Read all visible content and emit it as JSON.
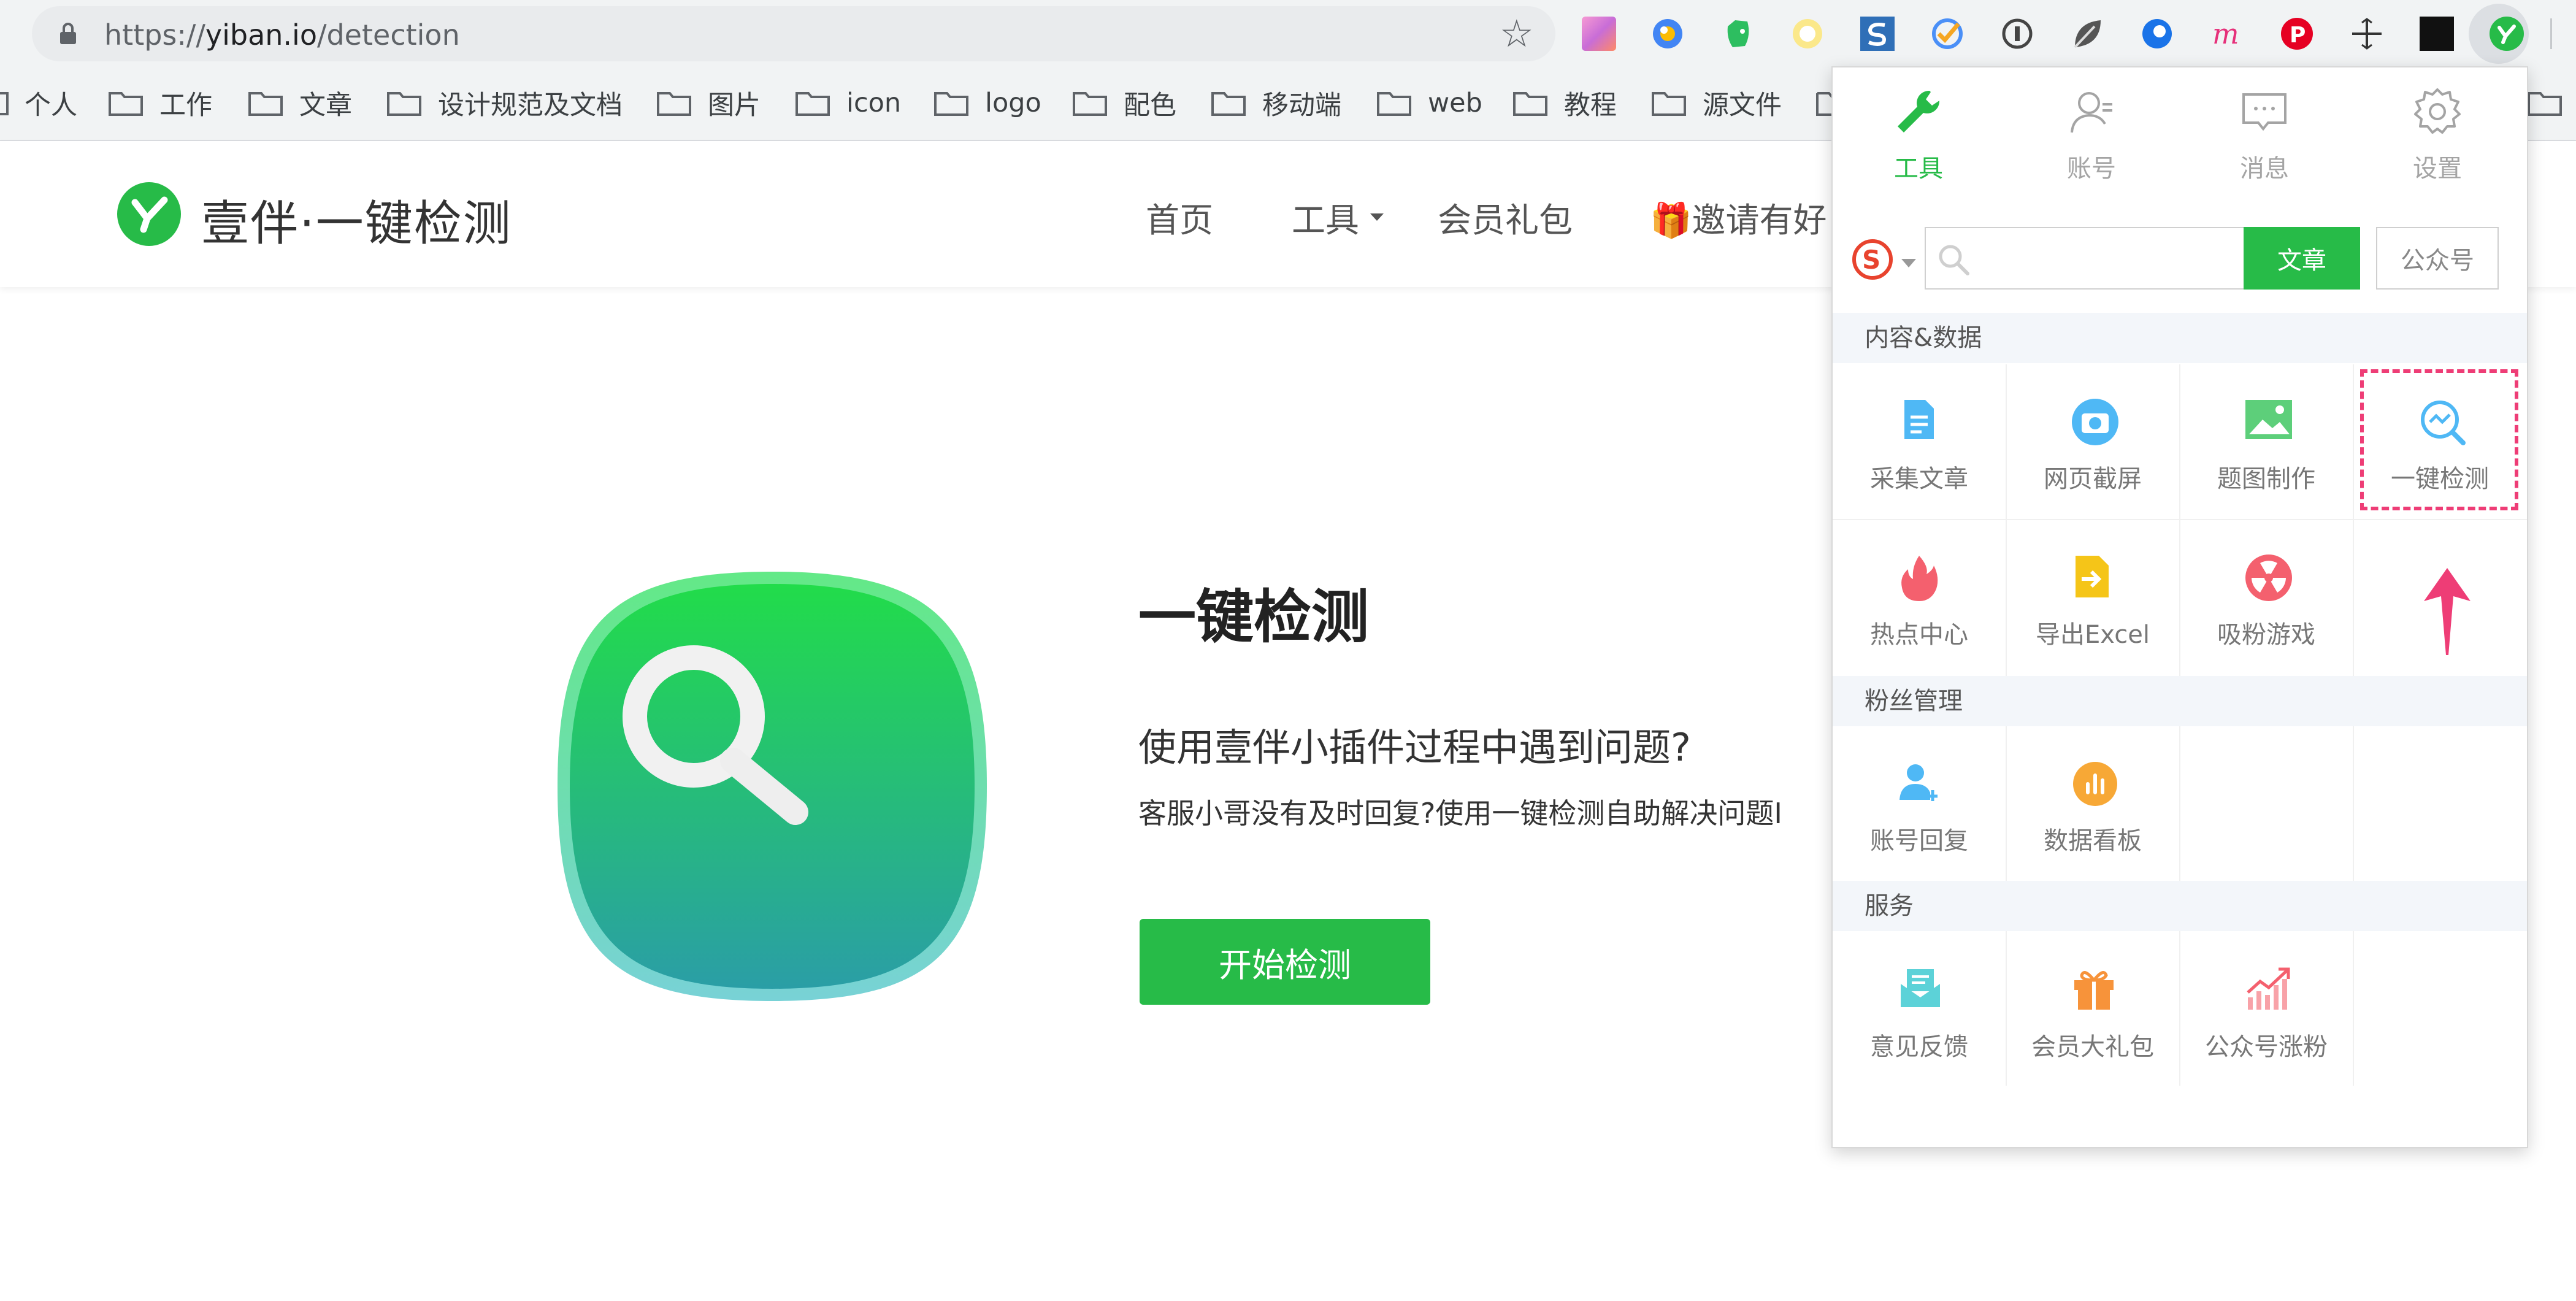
{
  "browser": {
    "url_scheme": "https://",
    "url_host": "yiban.io",
    "url_path": "/detection",
    "bookmarks": [
      "个人",
      "工作",
      "文章",
      "设计规范及文档",
      "图片",
      "icon",
      "logo",
      "配色",
      "移动端",
      "web",
      "教程",
      "源文件"
    ],
    "extensions": [
      "paint-palette-extension-icon",
      "globe-extension-icon",
      "evernote-icon",
      "circle-extension-icon",
      "s-logo-extension-icon",
      "check-extension-icon",
      "info-extension-icon",
      "leaf-extension-icon",
      "blue-circle-extension-icon",
      "m-extension-icon",
      "pinterest-icon",
      "crosshair-extension-icon",
      "black-square-extension-icon",
      "yiban-extension-icon"
    ]
  },
  "site": {
    "name": "壹伴·一键检测",
    "nav": {
      "home": "首页",
      "tools": "工具",
      "vip": "会员礼包",
      "invite": "🎁邀请有好"
    },
    "brand_color": "#27bb48"
  },
  "hero": {
    "title": "一键检测",
    "subtitle": "使用壹伴小插件过程中遇到问题?",
    "desc": "客服小哥没有及时回复?使用一键检测自助解决问题I",
    "button": "开始检测"
  },
  "popup": {
    "tabs": [
      {
        "label": "工具",
        "icon": "wrench-icon",
        "active": true
      },
      {
        "label": "账号",
        "icon": "user-icon",
        "active": false
      },
      {
        "label": "消息",
        "icon": "message-icon",
        "active": false
      },
      {
        "label": "设置",
        "icon": "gear-icon",
        "active": false
      }
    ],
    "search": {
      "engine_icon": "sogou-icon",
      "placeholder": "",
      "btn_article": "文章",
      "btn_account": "公众号"
    },
    "sections": {
      "content": "内容&数据",
      "fans": "粉丝管理",
      "service": "服务"
    },
    "content_items": [
      "采集文章",
      "网页截屏",
      "题图制作",
      "一键检测",
      "热点中心",
      "导出Excel",
      "吸粉游戏"
    ],
    "fans_items": [
      "账号回复",
      "数据看板"
    ],
    "service_items": [
      "意见反馈",
      "会员大礼包",
      "公众号涨粉"
    ],
    "highlight_color": "#ee3d76"
  }
}
